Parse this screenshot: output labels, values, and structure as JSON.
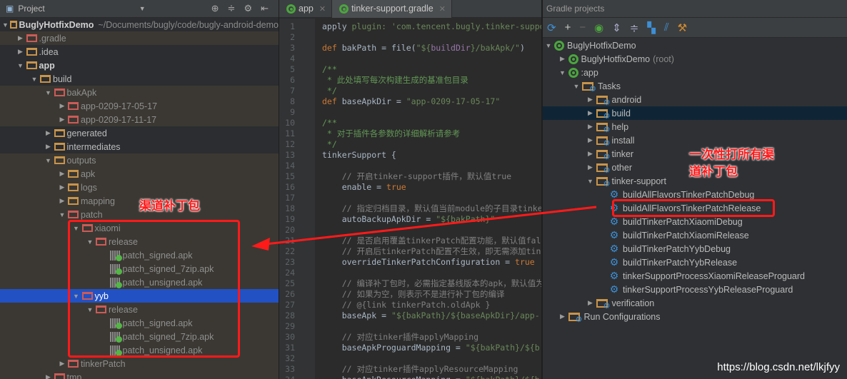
{
  "project_panel": {
    "title": "Project",
    "toolbar_icons": [
      "locate-icon",
      "collapse-icon",
      "gear-icon",
      "hide-icon"
    ],
    "rows": [
      {
        "label": "BuglyHotfixDemo",
        "extra": "~/Documents/bugly/code/bugly-android-demo",
        "depth": 0,
        "state": "expanded",
        "icon": "project",
        "bold": true
      },
      {
        "label": ".gradle",
        "depth": 1,
        "state": "collapsed",
        "icon": "red",
        "excluded": true
      },
      {
        "label": ".idea",
        "depth": 1,
        "state": "collapsed",
        "icon": "folder"
      },
      {
        "label": "app",
        "depth": 1,
        "state": "expanded",
        "icon": "module",
        "bold": true
      },
      {
        "label": "build",
        "depth": 2,
        "state": "expanded",
        "icon": "folder"
      },
      {
        "label": "bakApk",
        "depth": 3,
        "state": "expanded",
        "icon": "red",
        "excluded": true
      },
      {
        "label": "app-0209-17-05-17",
        "depth": 4,
        "state": "collapsed",
        "icon": "red",
        "excluded": true
      },
      {
        "label": "app-0209-17-11-17",
        "depth": 4,
        "state": "collapsed",
        "icon": "red",
        "excluded": true
      },
      {
        "label": "generated",
        "depth": 3,
        "state": "collapsed",
        "icon": "folder"
      },
      {
        "label": "intermediates",
        "depth": 3,
        "state": "collapsed",
        "icon": "folder"
      },
      {
        "label": "outputs",
        "depth": 3,
        "state": "expanded",
        "icon": "folder",
        "excluded": true
      },
      {
        "label": "apk",
        "depth": 4,
        "state": "collapsed",
        "icon": "folder",
        "excluded": true
      },
      {
        "label": "logs",
        "depth": 4,
        "state": "collapsed",
        "icon": "folder",
        "excluded": true
      },
      {
        "label": "mapping",
        "depth": 4,
        "state": "collapsed",
        "icon": "folder",
        "excluded": true
      },
      {
        "label": "patch",
        "depth": 4,
        "state": "expanded",
        "icon": "red",
        "excluded": true
      },
      {
        "label": "xiaomi",
        "depth": 5,
        "state": "expanded",
        "icon": "red",
        "excluded": true
      },
      {
        "label": "release",
        "depth": 6,
        "state": "expanded",
        "icon": "red",
        "excluded": true
      },
      {
        "label": "patch_signed.apk",
        "depth": 7,
        "state": "leaf",
        "icon": "apk",
        "excluded": true
      },
      {
        "label": "patch_signed_7zip.apk",
        "depth": 7,
        "state": "leaf",
        "icon": "apk",
        "excluded": true
      },
      {
        "label": "patch_unsigned.apk",
        "depth": 7,
        "state": "leaf",
        "icon": "apk",
        "excluded": true
      },
      {
        "label": "yyb",
        "depth": 5,
        "state": "expanded",
        "icon": "red",
        "selected": true
      },
      {
        "label": "release",
        "depth": 6,
        "state": "expanded",
        "icon": "red",
        "excluded": true
      },
      {
        "label": "patch_signed.apk",
        "depth": 7,
        "state": "leaf",
        "icon": "apk",
        "excluded": true
      },
      {
        "label": "patch_signed_7zip.apk",
        "depth": 7,
        "state": "leaf",
        "icon": "apk",
        "excluded": true
      },
      {
        "label": "patch_unsigned.apk",
        "depth": 7,
        "state": "leaf",
        "icon": "apk",
        "excluded": true
      },
      {
        "label": "tinkerPatch",
        "depth": 4,
        "state": "collapsed",
        "icon": "red",
        "excluded": true
      },
      {
        "label": "tmp",
        "depth": 3,
        "state": "collapsed",
        "icon": "red",
        "excluded": true
      }
    ]
  },
  "editor": {
    "tabs": [
      {
        "label": "app",
        "active": false
      },
      {
        "label": "tinker-support.gradle",
        "active": true
      }
    ],
    "lines": [
      [
        [
          "t",
          "apply "
        ],
        [
          "s",
          "plugin: 'com.tencent.bugly.tinker-support'"
        ]
      ],
      [],
      [
        [
          "k",
          "def "
        ],
        [
          "t",
          "bakPath = file("
        ],
        [
          "s",
          "\"${"
        ],
        [
          "p",
          "buildDir"
        ],
        [
          "s",
          "}/bakApk/\""
        ],
        [
          "t",
          ")"
        ]
      ],
      [],
      [
        [
          "d",
          "/**"
        ]
      ],
      [
        [
          "d",
          " * 此处填写每次构建生成的基准包目录"
        ]
      ],
      [
        [
          "d",
          " */"
        ]
      ],
      [
        [
          "k",
          "def "
        ],
        [
          "t",
          "baseApkDir = "
        ],
        [
          "s",
          "\"app-0209-17-05-17\""
        ]
      ],
      [],
      [
        [
          "d",
          "/**"
        ]
      ],
      [
        [
          "d",
          " * 对于插件各参数的详细解析请参考"
        ]
      ],
      [
        [
          "d",
          " */"
        ]
      ],
      [
        [
          "t",
          "tinkerSupport {"
        ]
      ],
      [],
      [
        [
          "c",
          "    // 开启tinker-support插件，默认值true"
        ]
      ],
      [
        [
          "t",
          "    enable = "
        ],
        [
          "k",
          "true"
        ]
      ],
      [],
      [
        [
          "c",
          "    // 指定归档目录，默认值当前module的子目录tinker"
        ]
      ],
      [
        [
          "t",
          "    autoBackupApkDir = "
        ],
        [
          "s",
          "\"${bakPath}\""
        ]
      ],
      [],
      [
        [
          "c",
          "    // 是否启用覆盖tinkerPatch配置功能，默认值false"
        ]
      ],
      [
        [
          "c",
          "    // 开启后tinkerPatch配置不生效，即无需添加tinkerPatch"
        ]
      ],
      [
        [
          "t",
          "    overrideTinkerPatchConfiguration = "
        ],
        [
          "k",
          "true"
        ]
      ],
      [],
      [
        [
          "c",
          "    // 编译补丁包时，必需指定基线版本的apk，默认值为空"
        ]
      ],
      [
        [
          "c",
          "    // 如果为空，则表示不是进行补丁包的编译"
        ]
      ],
      [
        [
          "c",
          "    // @{link tinkerPatch.oldApk }"
        ]
      ],
      [
        [
          "t",
          "    baseApk = "
        ],
        [
          "s",
          "\"${bakPath}/${baseApkDir}/app-"
        ]
      ],
      [],
      [
        [
          "c",
          "    // 对应tinker插件applyMapping"
        ]
      ],
      [
        [
          "t",
          "    baseApkProguardMapping = "
        ],
        [
          "s",
          "\"${bakPath}/${b"
        ]
      ],
      [],
      [
        [
          "c",
          "    // 对应tinker插件applyResourceMapping"
        ]
      ],
      [
        [
          "t",
          "    baseApkResourceMapping = "
        ],
        [
          "s",
          "\"${bakPath}/${b"
        ]
      ]
    ]
  },
  "gradle_panel": {
    "title": "Gradle projects",
    "toolbar_icons": [
      "refresh-icon",
      "add-icon",
      "remove-icon",
      "execute-task-icon",
      "expand-all-icon",
      "collapse-all-icon",
      "group-modules-icon",
      "toggle-offline-icon",
      "settings-icon"
    ],
    "rows": [
      {
        "label": "BuglyHotfixDemo",
        "depth": 0,
        "state": "expanded",
        "icon": "gradle"
      },
      {
        "label": "BuglyHotfixDemo",
        "extra": "(root)",
        "depth": 1,
        "state": "collapsed",
        "icon": "gradle"
      },
      {
        "label": ":app",
        "depth": 1,
        "state": "expanded",
        "icon": "gradle"
      },
      {
        "label": "Tasks",
        "depth": 2,
        "state": "expanded",
        "icon": "taskfolder"
      },
      {
        "label": "android",
        "depth": 3,
        "state": "collapsed",
        "icon": "taskfolder"
      },
      {
        "label": "build",
        "depth": 3,
        "state": "collapsed",
        "icon": "taskfolder",
        "selected": true
      },
      {
        "label": "help",
        "depth": 3,
        "state": "collapsed",
        "icon": "taskfolder"
      },
      {
        "label": "install",
        "depth": 3,
        "state": "collapsed",
        "icon": "taskfolder"
      },
      {
        "label": "tinker",
        "depth": 3,
        "state": "collapsed",
        "icon": "taskfolder"
      },
      {
        "label": "other",
        "depth": 3,
        "state": "collapsed",
        "icon": "taskfolder"
      },
      {
        "label": "tinker-support",
        "depth": 3,
        "state": "expanded",
        "icon": "taskfolder"
      },
      {
        "label": "buildAllFlavorsTinkerPatchDebug",
        "depth": 4,
        "state": "leaf",
        "icon": "task"
      },
      {
        "label": "buildAllFlavorsTinkerPatchRelease",
        "depth": 4,
        "state": "leaf",
        "icon": "task"
      },
      {
        "label": "buildTinkerPatchXiaomiDebug",
        "depth": 4,
        "state": "leaf",
        "icon": "task"
      },
      {
        "label": "buildTinkerPatchXiaomiRelease",
        "depth": 4,
        "state": "leaf",
        "icon": "task"
      },
      {
        "label": "buildTinkerPatchYybDebug",
        "depth": 4,
        "state": "leaf",
        "icon": "task"
      },
      {
        "label": "buildTinkerPatchYybRelease",
        "depth": 4,
        "state": "leaf",
        "icon": "task"
      },
      {
        "label": "tinkerSupportProcessXiaomiReleaseProguard",
        "depth": 4,
        "state": "leaf",
        "icon": "task"
      },
      {
        "label": "tinkerSupportProcessYybReleaseProguard",
        "depth": 4,
        "state": "leaf",
        "icon": "task"
      },
      {
        "label": "verification",
        "depth": 3,
        "state": "collapsed",
        "icon": "taskfolder"
      },
      {
        "label": "Run Configurations",
        "depth": 1,
        "state": "collapsed",
        "icon": "taskfolder"
      }
    ]
  },
  "annotations": {
    "left_label": "渠道补丁包",
    "right_label_line1": "一次性打所有渠",
    "right_label_line2": "道补丁包",
    "color": "#ff1a1a"
  },
  "watermark": "https://blog.csdn.net/lkjfyy"
}
